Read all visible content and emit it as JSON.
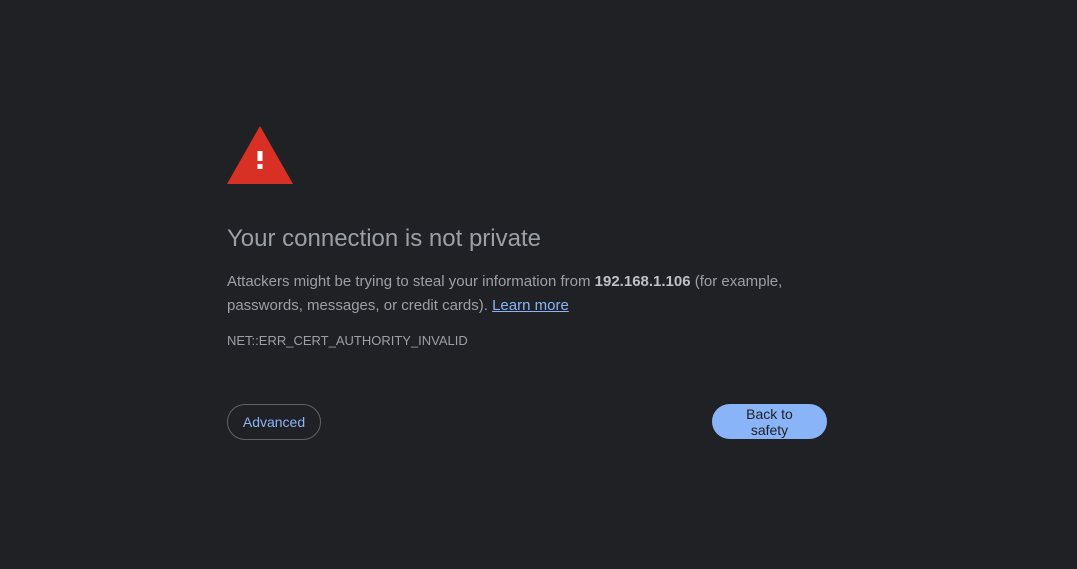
{
  "page": {
    "icon": "warning-triangle-icon",
    "heading": "Your connection is not private",
    "summary": {
      "prefix": "Attackers might be trying to steal your information from ",
      "host": "192.168.1.106",
      "suffix": " (for example, passwords, messages, or credit cards). ",
      "learn_more": "Learn more"
    },
    "error_code": "NET::ERR_CERT_AUTHORITY_INVALID"
  },
  "buttons": {
    "advanced": "Advanced",
    "back_to_safety": "Back to safety"
  },
  "colors": {
    "background": "#202124",
    "warning_red": "#d93025",
    "link_blue": "#8ab4f8",
    "primary_button": "#8ab4f8"
  }
}
